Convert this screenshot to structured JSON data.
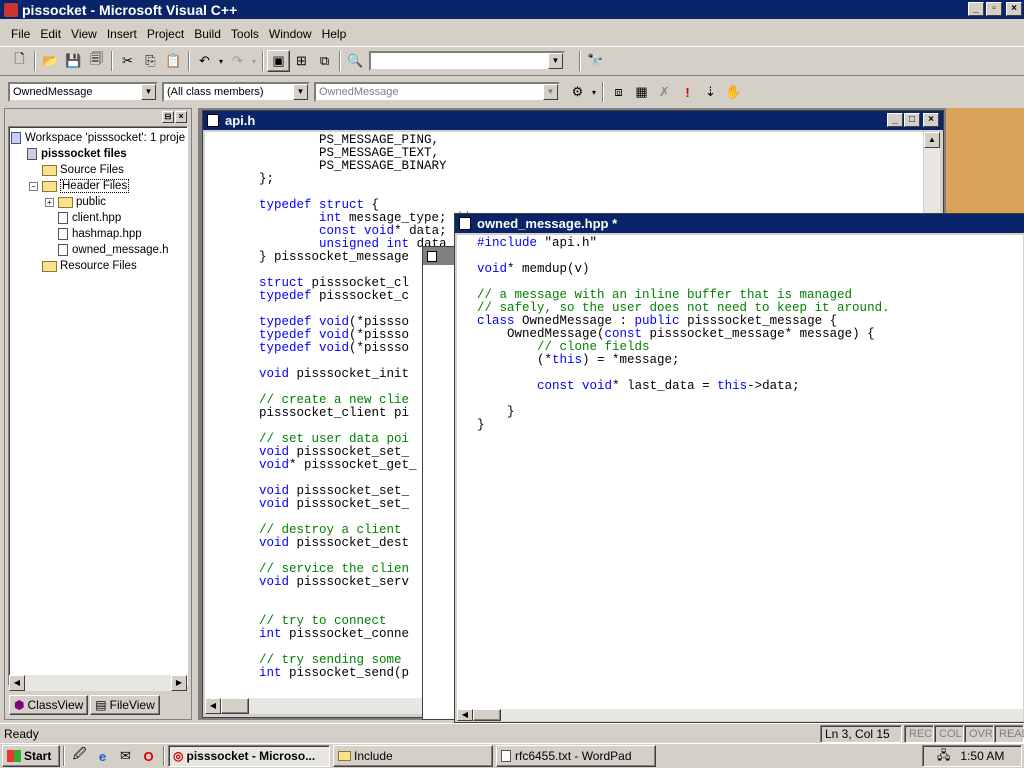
{
  "window": {
    "title": "pissocket - Microsoft Visual C++"
  },
  "menu": [
    "File",
    "Edit",
    "View",
    "Insert",
    "Project",
    "Build",
    "Tools",
    "Window",
    "Help"
  ],
  "wizard_bar": {
    "class_combo": "OwnedMessage",
    "filter_combo": "(All class members)",
    "member_combo": "OwnedMessage"
  },
  "workspace": {
    "tree": [
      {
        "label": "Workspace 'pisssocket': 1 proje",
        "indent": 0,
        "kind": "workspace"
      },
      {
        "label": "pisssocket files",
        "indent": 1,
        "kind": "project",
        "bold": true
      },
      {
        "label": "Source Files",
        "indent": 2,
        "kind": "folder"
      },
      {
        "label": "Header Files",
        "indent": 2,
        "kind": "folder-open",
        "selected": true
      },
      {
        "label": "public",
        "indent": 3,
        "kind": "folder"
      },
      {
        "label": "client.hpp",
        "indent": 3,
        "kind": "file"
      },
      {
        "label": "hashmap.hpp",
        "indent": 3,
        "kind": "file"
      },
      {
        "label": "owned_message.h",
        "indent": 3,
        "kind": "file"
      },
      {
        "label": "Resource Files",
        "indent": 2,
        "kind": "folder"
      }
    ],
    "tabs": [
      "ClassView",
      "FileView"
    ]
  },
  "api_window": {
    "title": "api.h",
    "lines": [
      "        PS_MESSAGE_PING,",
      "        PS_MESSAGE_TEXT,",
      "        PS_MESSAGE_BINARY",
      "};",
      "",
      "typedef struct {",
      "        int message_type; //",
      "        const void* data;",
      "        unsigned int data",
      "} pisssocket_message",
      "",
      "struct pisssocket_cl",
      "typedef pisssocket_c",
      "",
      "typedef void(*pissso",
      "typedef void(*pissso",
      "typedef void(*pissso",
      "",
      "void pisssocket_init",
      "",
      "// create a new clie",
      "pisssocket_client pi",
      "",
      "// set user data poi",
      "void pisssocket_set_",
      "void* pisssocket_get_",
      "",
      "void pisssocket_set_",
      "void pisssocket_set_",
      "",
      "// destroy a client",
      "void pisssocket_dest",
      "",
      "// service the clien",
      "void pisssocket_serv",
      "",
      "",
      "// try to connect",
      "int pisssocket_conne",
      "",
      "// try sending some",
      "int pissocket_send(p"
    ]
  },
  "owned_window": {
    "title": "owned_message.hpp *",
    "lines": [
      "#include \"api.h\"",
      "",
      "void* memdup(v)",
      "",
      "// a message with an inline buffer that is managed",
      "// safely, so the user does not need to keep it around.",
      "class OwnedMessage : public pisssocket_message {",
      "    OwnedMessage(const pisssocket_message* message) {",
      "        // clone fields",
      "        (*this) = *message;",
      "",
      "        const void* last_data = this->data;",
      "",
      "    }",
      "}"
    ]
  },
  "status": {
    "text": "Ready",
    "position": "Ln 3, Col 15",
    "indicators": [
      "REC",
      "COL",
      "OVR",
      "READ"
    ]
  },
  "taskbar": {
    "start": "Start",
    "tasks": [
      "pisssocket - Microso...",
      "Include",
      "rfc6455.txt - WordPad"
    ],
    "clock": "1:50 AM"
  }
}
